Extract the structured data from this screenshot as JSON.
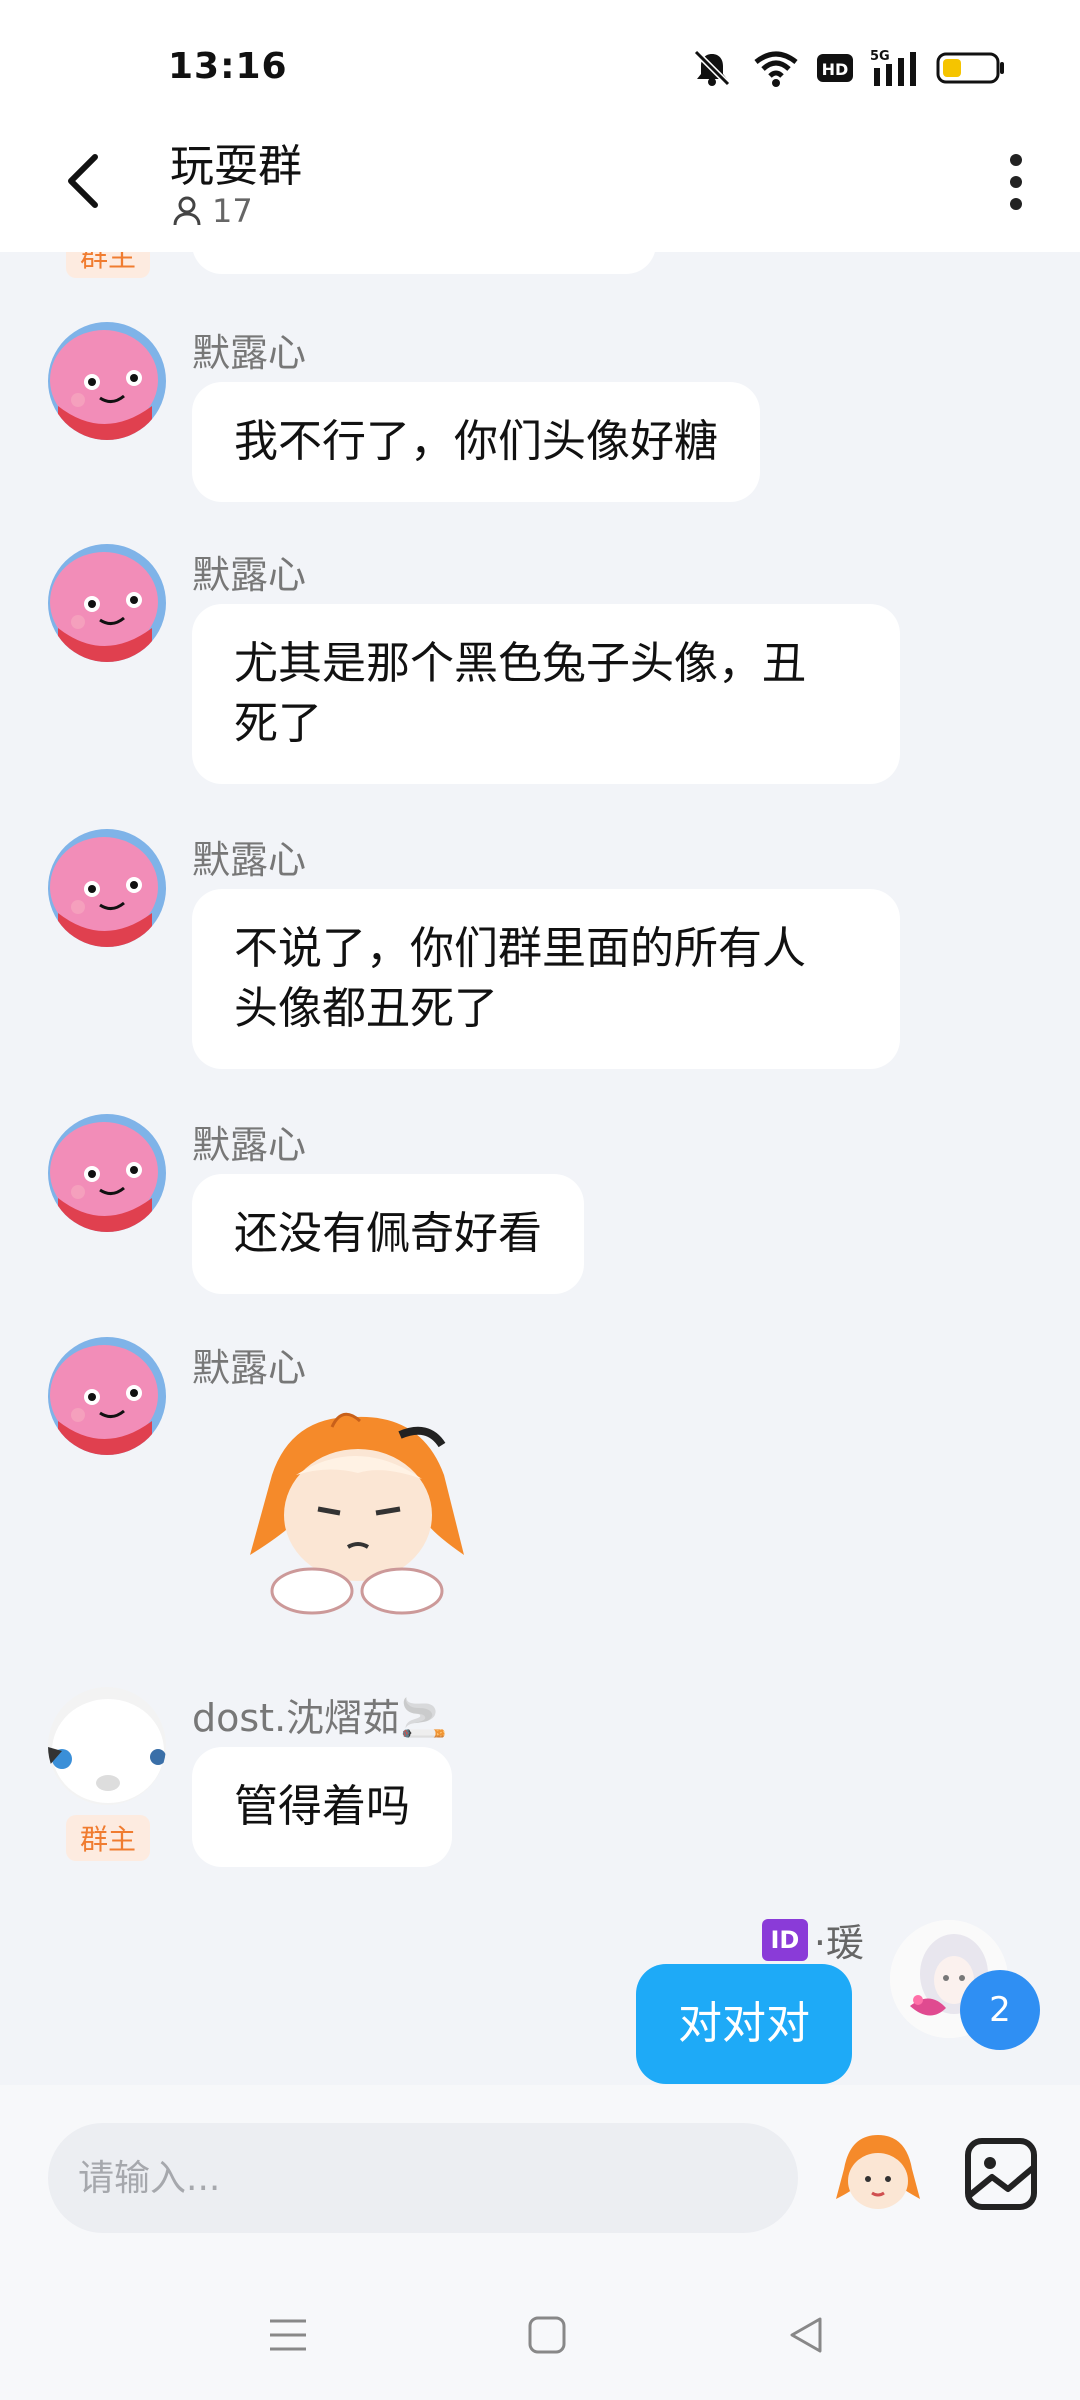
{
  "status_bar": {
    "time": "13:16",
    "icons": [
      "mute-icon",
      "wifi-icon",
      "hd-icon",
      "5g-signal-icon",
      "battery-icon"
    ],
    "network_label": "5G",
    "hd_label": "HD"
  },
  "header": {
    "title": "玩耍群",
    "member_count": "17"
  },
  "chat": {
    "partial_top_badge": "群主",
    "messages": [
      {
        "sender": "默露心",
        "text": "我不行了，你们头像好糖"
      },
      {
        "sender": "默露心",
        "text_line1": "尤其是那个黑色兔子头像，丑",
        "text_line2": "死了"
      },
      {
        "sender": "默露心",
        "text_line1": "不说了，你们群里面的所有人",
        "text_line2": "头像都丑死了"
      },
      {
        "sender": "默露心",
        "text": "还没有佩奇好看"
      },
      {
        "sender": "默露心",
        "sticker": "orange-hair-girl-sticker"
      },
      {
        "sender": "dost.沈熠茹🚬",
        "badge": "群主",
        "text": "管得着吗"
      }
    ],
    "self_message": {
      "name_tag": "ID",
      "name": "·瑗",
      "text": "对对对",
      "unread_count": "2"
    }
  },
  "input": {
    "placeholder": "请输入..."
  },
  "colors": {
    "accent": "#1eaaf7",
    "background": "#f2f4f8",
    "owner_badge_bg": "#fdebe0",
    "owner_badge_text": "#f07c30",
    "unread": "#2f8ff3"
  }
}
